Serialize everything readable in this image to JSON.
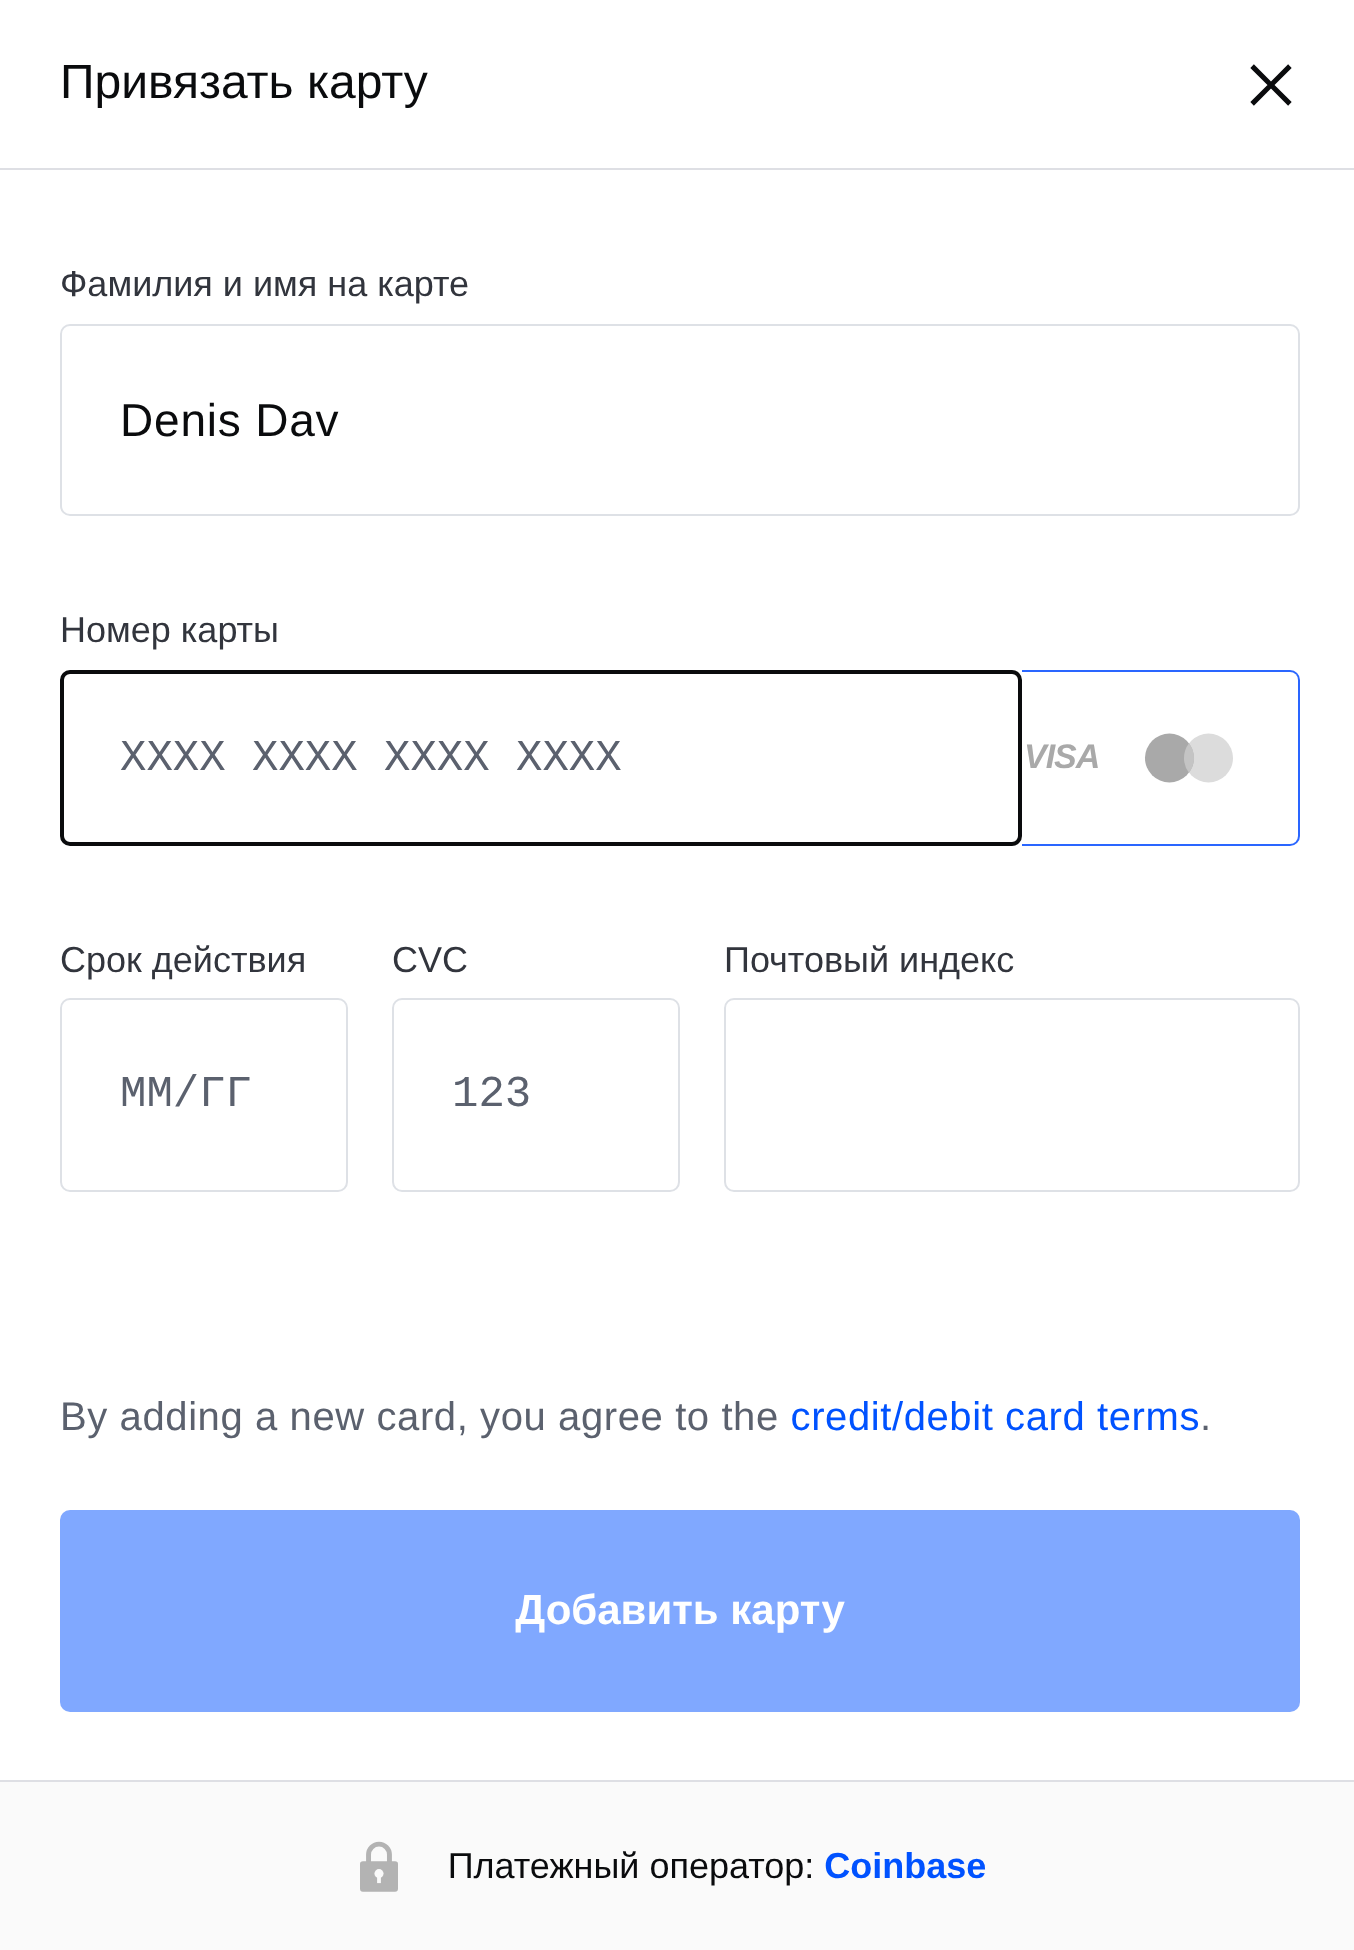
{
  "header": {
    "title": "Привязать карту"
  },
  "name_field": {
    "label": "Фамилия и имя на карте",
    "value": "Denis Dav"
  },
  "card_number": {
    "label": "Номер карты",
    "placeholder": "XXXX XXXX XXXX XXXX",
    "focused": true,
    "brand_text": "VISA"
  },
  "row_fields": [
    {
      "label": "Срок действия",
      "placeholder": "ММ/ГГ"
    },
    {
      "label": "CVC",
      "placeholder": "123"
    },
    {
      "label": "Почтовый индекс"
    }
  ],
  "terms": {
    "text": "By adding a new card, you agree to the ",
    "link": "credit/debit card terms",
    "end": "."
  },
  "submit_button": {
    "label": "Добавить карту",
    "disabled": true
  },
  "footer": {
    "text": "Платежный оператор: ",
    "link": "Coinbase"
  }
}
